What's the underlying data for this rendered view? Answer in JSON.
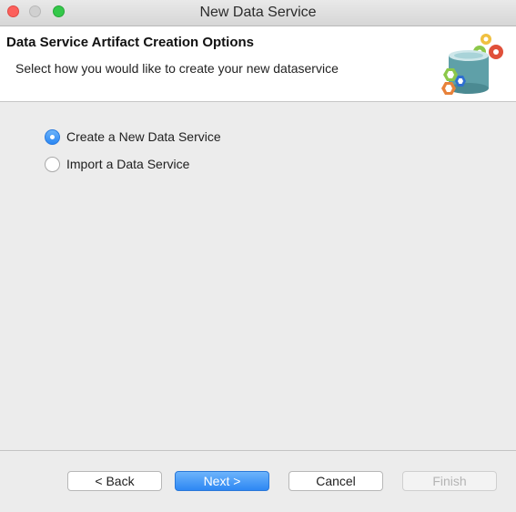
{
  "window": {
    "title": "New Data Service"
  },
  "banner": {
    "title": "Data Service Artifact Creation Options",
    "subtitle": "Select how you would like to create your new dataservice",
    "icon": "data-service-gears-icon"
  },
  "options": [
    {
      "label": "Create a New Data Service",
      "selected": true
    },
    {
      "label": "Import a Data Service",
      "selected": false
    }
  ],
  "buttons": {
    "back": "< Back",
    "next": "Next >",
    "cancel": "Cancel",
    "finish": "Finish"
  },
  "colors": {
    "accent": "#2d87f3",
    "close": "#fc605c",
    "maximize": "#34c84a"
  }
}
